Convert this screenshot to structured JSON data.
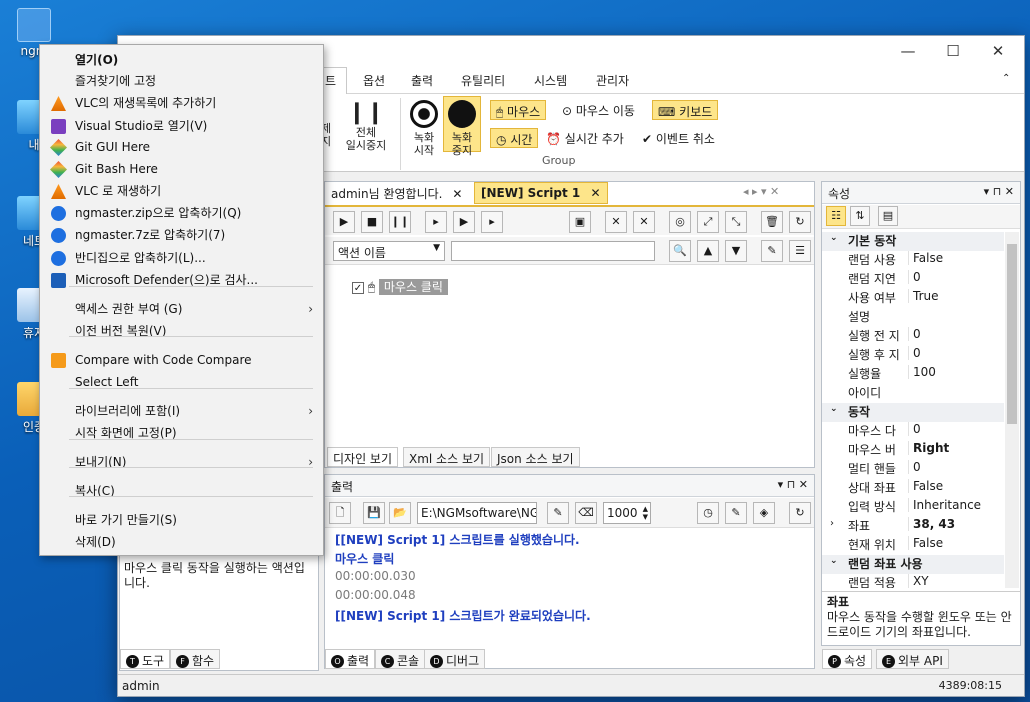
{
  "desktop": {
    "icons": [
      {
        "label": "ngm",
        "icon": "user-folder-icon"
      },
      {
        "label": "내",
        "icon": "pc-icon"
      },
      {
        "label": "네트",
        "icon": "network-icon"
      },
      {
        "label": "휴지",
        "icon": "recycle-bin-icon"
      },
      {
        "label": "인증",
        "icon": "folder-icon"
      }
    ]
  },
  "window": {
    "title_controls": {
      "minimize": "—",
      "maximize": "☐",
      "close": "✕"
    },
    "menu": [
      "트",
      "옵션",
      "출력",
      "유틸리티",
      "시스템",
      "관리자"
    ],
    "ribbon": {
      "pause_all_label_line1": "전체",
      "pause_all_label_line2": "일시중지",
      "partial_label_line1": "제",
      "partial_label_line2": "지",
      "record_start_line1": "녹화",
      "record_start_line2": "시작",
      "record_stop_line1": "녹화",
      "record_stop_line2": "중지",
      "mouse_toggle": "마우스",
      "mouse_move": "마우스 이동",
      "keyboard_toggle": "키보드",
      "time_toggle": "시간",
      "realtime_add": "실시간 추가",
      "event_cancel": "이벤트 취소",
      "group_label": "Group"
    },
    "doc_tabs": [
      {
        "label": "admin님 환영합니다.",
        "close": "✕"
      },
      {
        "label": "[NEW] Script 1",
        "close": "✕"
      }
    ],
    "script": {
      "action_name_select": "액션 이름",
      "tree_item": "마우스 클릭",
      "view_tabs": [
        "디자인 보기",
        "Xml 소스 보기",
        "Json 소스 보기"
      ]
    },
    "output": {
      "title": "출력",
      "path": "E:\\NGMsoftware\\NG",
      "number": "1000",
      "lines": [
        {
          "text": "[[NEW] Script 1] 스크립트를 실행했습니다.",
          "color": "#1f3fbf"
        },
        {
          "text": "마우스 클릭",
          "color": "#1f3fbf"
        },
        {
          "text": "00:00:00.030",
          "color": "#7a7a7a"
        },
        {
          "text": "00:00:00.048",
          "color": "#7a7a7a"
        },
        {
          "text": "[[NEW] Script 1] 스크립트가 완료되었습니다.",
          "color": "#1f3fbf"
        }
      ],
      "tabs": [
        {
          "badge": "O",
          "label": "출력"
        },
        {
          "badge": "C",
          "label": "콘솔"
        },
        {
          "badge": "D",
          "label": "디버그"
        }
      ]
    },
    "left_panel": {
      "description": "마우스 클릭 동작을 실행하는 액션입니다.",
      "tabs": [
        {
          "badge": "T",
          "label": "도구"
        },
        {
          "badge": "F",
          "label": "함수"
        }
      ]
    },
    "properties": {
      "title": "속성",
      "categories": [
        {
          "name": "기본 동작",
          "rows": [
            {
              "key": "랜덤 사용",
              "value": "False"
            },
            {
              "key": "랜덤 지연",
              "value": "0"
            },
            {
              "key": "사용 여부",
              "value": "True"
            },
            {
              "key": "설명",
              "value": ""
            },
            {
              "key": "실행 전 지",
              "value": "0"
            },
            {
              "key": "실행 후 지",
              "value": "0"
            },
            {
              "key": "실행율",
              "value": "100"
            },
            {
              "key": "아이디",
              "value": ""
            }
          ]
        },
        {
          "name": "동작",
          "rows": [
            {
              "key": "마우스 다",
              "value": "0"
            },
            {
              "key": "마우스 버",
              "value": "Right",
              "bold": true
            },
            {
              "key": "멀티 핸들",
              "value": "0"
            },
            {
              "key": "상대 좌표",
              "value": "False"
            },
            {
              "key": "입력 방식",
              "value": "Inheritance"
            },
            {
              "key": "좌표",
              "value": "38, 43",
              "bold": true,
              "expand": true
            },
            {
              "key": "현재 위치",
              "value": "False"
            }
          ]
        },
        {
          "name": "랜덤 좌표 사용",
          "rows": [
            {
              "key": "랜덤 적용",
              "value": "XY"
            }
          ]
        }
      ],
      "desc_title": "좌표",
      "desc_text": "마우스 동작을 수행할 윈도우 또는 안드로이드 기기의 좌표입니다.",
      "tabs": [
        {
          "badge": "P",
          "label": "속성"
        },
        {
          "badge": "E",
          "label": "외부 API"
        }
      ]
    },
    "status": {
      "user": "admin",
      "clock": "4389:08:15"
    }
  },
  "context_menu": {
    "items": [
      {
        "label": "열기(O)",
        "bold": true,
        "icon": ""
      },
      {
        "label": "즐겨찾기에 고정",
        "icon": ""
      },
      {
        "label": "VLC의 재생목록에 추가하기",
        "icon": "vlc-icon"
      },
      {
        "label": "Visual Studio로 열기(V)",
        "icon": "visual-studio-icon"
      },
      {
        "label": "Git GUI Here",
        "icon": "git-icon"
      },
      {
        "label": "Git Bash Here",
        "icon": "git-icon"
      },
      {
        "label": "VLC 로 재생하기",
        "icon": "vlc-icon"
      },
      {
        "label": "ngmaster.zip으로 압축하기(Q)",
        "icon": "bandizip-icon"
      },
      {
        "label": "ngmaster.7z로 압축하기(7)",
        "icon": "bandizip-icon"
      },
      {
        "label": "반디집으로 압축하기(L)...",
        "icon": "bandizip-icon"
      },
      {
        "label": "Microsoft Defender(으)로 검사...",
        "icon": "defender-icon"
      },
      {
        "label": "액세스 권한 부여 (G)",
        "icon": "",
        "submenu": true
      },
      {
        "label": "이전 버전 복원(V)",
        "icon": ""
      },
      {
        "label": "Compare with Code Compare",
        "icon": "code-compare-icon"
      },
      {
        "label": "Select Left",
        "icon": ""
      },
      {
        "label": "라이브러리에 포함(I)",
        "icon": "",
        "submenu": true
      },
      {
        "label": "시작 화면에 고정(P)",
        "icon": ""
      },
      {
        "label": "보내기(N)",
        "icon": "",
        "submenu": true
      },
      {
        "label": "복사(C)",
        "icon": ""
      },
      {
        "label": "바로 가기 만들기(S)",
        "icon": ""
      },
      {
        "label": "삭제(D)",
        "icon": ""
      }
    ],
    "arrow": "›"
  },
  "colors": {
    "toggle_bg": "#fde58a",
    "accent": "#1f3fbf",
    "desktop": "#0a5fb8"
  }
}
